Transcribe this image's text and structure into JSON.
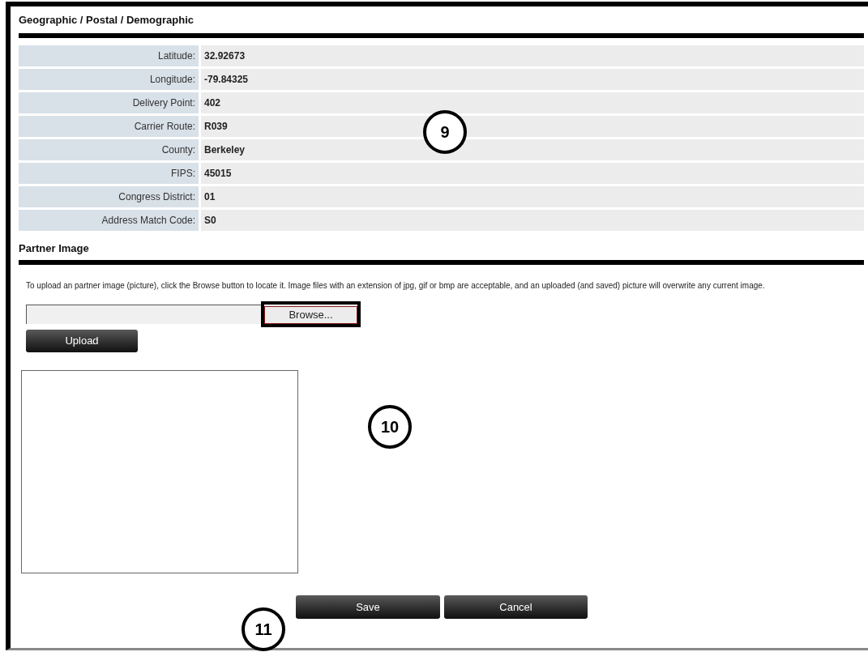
{
  "geo_section": {
    "title": "Geographic / Postal / Demographic",
    "rows": [
      {
        "label": "Latitude:",
        "value": "32.92673"
      },
      {
        "label": "Longitude:",
        "value": "-79.84325"
      },
      {
        "label": "Delivery Point:",
        "value": "402"
      },
      {
        "label": "Carrier Route:",
        "value": "R039"
      },
      {
        "label": "County:",
        "value": "Berkeley"
      },
      {
        "label": "FIPS:",
        "value": "45015"
      },
      {
        "label": "Congress District:",
        "value": "01"
      },
      {
        "label": "Address Match Code:",
        "value": "S0"
      }
    ]
  },
  "partner_image": {
    "title": "Partner Image",
    "instructions": "To upload an partner image (picture), click the Browse button to locate it.  Image files with an extension of jpg, gif or bmp are acceptable, and an uploaded (and saved) picture will overwrite any current image.",
    "browse_button": "Browse...",
    "upload_button": "Upload"
  },
  "buttons": [
    "Save",
    "Cancel"
  ],
  "callouts": [
    "9",
    "10",
    "11"
  ]
}
